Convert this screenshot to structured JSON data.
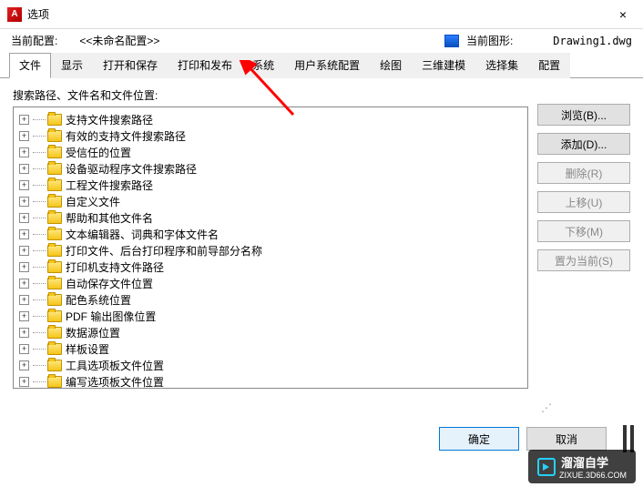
{
  "window": {
    "title": "选项",
    "close": "×"
  },
  "info": {
    "current_profile_label": "当前配置:",
    "current_profile_value": "<<未命名配置>>",
    "current_drawing_label": "当前图形:",
    "current_drawing_value": "Drawing1.dwg"
  },
  "tabs": [
    "文件",
    "显示",
    "打开和保存",
    "打印和发布",
    "系统",
    "用户系统配置",
    "绘图",
    "三维建模",
    "选择集",
    "配置"
  ],
  "active_tab_index": 0,
  "section_label": "搜索路径、文件名和文件位置:",
  "tree_items": [
    "支持文件搜索路径",
    "有效的支持文件搜索路径",
    "受信任的位置",
    "设备驱动程序文件搜索路径",
    "工程文件搜索路径",
    "自定义文件",
    "帮助和其他文件名",
    "文本编辑器、词典和字体文件名",
    "打印文件、后台打印程序和前导部分名称",
    "打印机支持文件路径",
    "自动保存文件位置",
    "配色系统位置",
    "PDF 输出图像位置",
    "数据源位置",
    "样板设置",
    "工具选项板文件位置",
    "编写选项板文件位置"
  ],
  "side_buttons": [
    {
      "label": "浏览(B)...",
      "enabled": true
    },
    {
      "label": "添加(D)...",
      "enabled": true
    },
    {
      "label": "删除(R)",
      "enabled": false
    },
    {
      "label": "上移(U)",
      "enabled": false
    },
    {
      "label": "下移(M)",
      "enabled": false
    },
    {
      "label": "置为当前(S)",
      "enabled": false
    }
  ],
  "footer": {
    "ok": "确定",
    "cancel": "取消"
  },
  "watermark": {
    "brand": "溜溜自学",
    "url": "ZIXUE.3D66.COM"
  }
}
